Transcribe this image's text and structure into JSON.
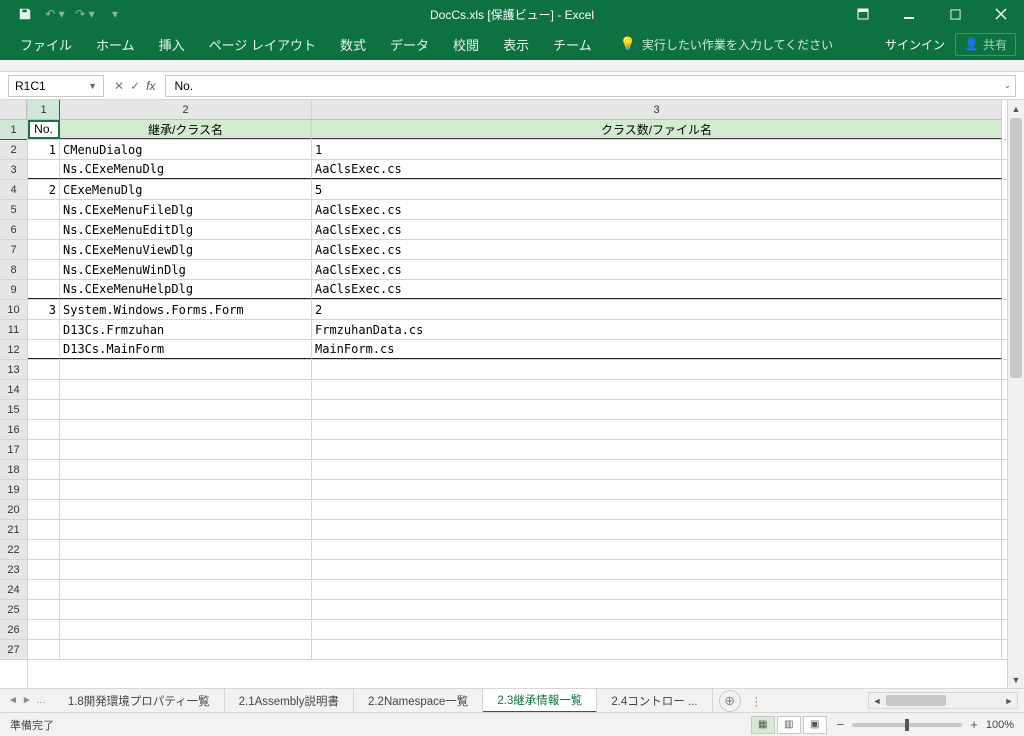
{
  "title": "DocCs.xls [保護ビュー] - Excel",
  "qat": {
    "save": "save-icon",
    "undo": "undo-icon",
    "redo": "redo-icon"
  },
  "tabs": [
    "ファイル",
    "ホーム",
    "挿入",
    "ページ レイアウト",
    "数式",
    "データ",
    "校閲",
    "表示",
    "チーム"
  ],
  "tell_me": "実行したい作業を入力してください",
  "signin": "サインイン",
  "share": "共有",
  "name_box": "R1C1",
  "formula": "No.",
  "columns": [
    "1",
    "2",
    "3"
  ],
  "header_row": [
    "No.",
    "継承/クラス名",
    "クラス数/ファイル名"
  ],
  "rows": [
    {
      "no": "1",
      "c2": "CMenuDialog",
      "c3": "1",
      "groupend": false
    },
    {
      "no": "",
      "c2": "Ns.CExeMenuDlg",
      "c3": "AaClsExec.cs",
      "groupend": true
    },
    {
      "no": "2",
      "c2": "CExeMenuDlg",
      "c3": "5",
      "groupend": false
    },
    {
      "no": "",
      "c2": "Ns.CExeMenuFileDlg",
      "c3": "AaClsExec.cs",
      "groupend": false
    },
    {
      "no": "",
      "c2": "Ns.CExeMenuEditDlg",
      "c3": "AaClsExec.cs",
      "groupend": false
    },
    {
      "no": "",
      "c2": "Ns.CExeMenuViewDlg",
      "c3": "AaClsExec.cs",
      "groupend": false
    },
    {
      "no": "",
      "c2": "Ns.CExeMenuWinDlg",
      "c3": "AaClsExec.cs",
      "groupend": false
    },
    {
      "no": "",
      "c2": "Ns.CExeMenuHelpDlg",
      "c3": "AaClsExec.cs",
      "groupend": true
    },
    {
      "no": "3",
      "c2": "System.Windows.Forms.Form",
      "c3": "2",
      "groupend": false
    },
    {
      "no": "",
      "c2": "D13Cs.Frmzuhan",
      "c3": "FrmzuhanData.cs",
      "groupend": false
    },
    {
      "no": "",
      "c2": "D13Cs.MainForm",
      "c3": "MainForm.cs",
      "groupend": true
    }
  ],
  "empty_rows": 15,
  "sheet_tabs": [
    {
      "label": "1.8開発環境プロパティ一覧",
      "active": false
    },
    {
      "label": "2.1Assembly説明書",
      "active": false
    },
    {
      "label": "2.2Namespace一覧",
      "active": false
    },
    {
      "label": "2.3継承情報一覧",
      "active": true
    },
    {
      "label": "2.4コントロー ...",
      "active": false
    }
  ],
  "status": "準備完了",
  "zoom": "100%"
}
